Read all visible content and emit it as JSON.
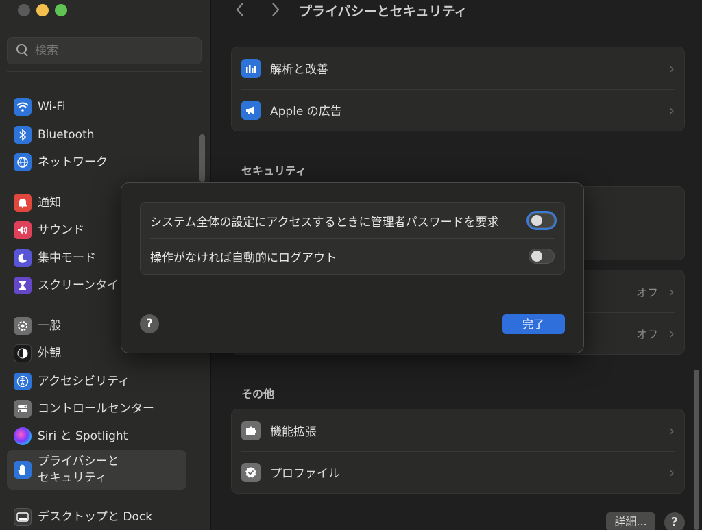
{
  "window": {
    "title": "プライバシーとセキュリティ"
  },
  "search": {
    "placeholder": "検索"
  },
  "sidebar": {
    "items": [
      {
        "label": "Wi-Fi",
        "icon": "wifi-icon"
      },
      {
        "label": "Bluetooth",
        "icon": "bluetooth-icon"
      },
      {
        "label": "ネットワーク",
        "icon": "globe-icon"
      },
      {
        "label": "通知",
        "icon": "bell-icon"
      },
      {
        "label": "サウンド",
        "icon": "speaker-icon"
      },
      {
        "label": "集中モード",
        "icon": "moon-icon"
      },
      {
        "label": "スクリーンタイ",
        "icon": "hourglass-icon"
      },
      {
        "label": "一般",
        "icon": "gear-icon"
      },
      {
        "label": "外観",
        "icon": "appearance-icon"
      },
      {
        "label": "アクセシビリティ",
        "icon": "accessibility-icon"
      },
      {
        "label": "コントロールセンター",
        "icon": "control-center-icon"
      },
      {
        "label": "Siri と Spotlight",
        "icon": "siri-icon"
      },
      {
        "label": "プライバシーと",
        "label2": "セキュリティ",
        "icon": "hand-icon",
        "selected": true
      },
      {
        "label": "デスクトップと Dock",
        "icon": "dock-icon"
      }
    ]
  },
  "main": {
    "privacy_rows": [
      {
        "label": "解析と改善",
        "icon": "chart-icon"
      },
      {
        "label": "Apple の広告",
        "icon": "megaphone-icon"
      }
    ],
    "security_title": "セキュリティ",
    "security_rows": [
      {
        "value": "オフ"
      },
      {
        "value": "オフ"
      }
    ],
    "other_title": "その他",
    "other_rows": [
      {
        "label": "機能拡張",
        "icon": "puzzle-icon"
      },
      {
        "label": "プロファイル",
        "icon": "checkmark-badge-icon"
      }
    ],
    "details_label": "詳細...",
    "help_label": "?"
  },
  "dialog": {
    "rows": [
      {
        "label": "システム全体の設定にアクセスするときに管理者パスワードを要求",
        "on": false
      },
      {
        "label": "操作がなければ自動的にログアウト",
        "on": false
      }
    ],
    "help_label": "?",
    "done_label": "完了"
  },
  "colors": {
    "accent": "#2f6fdc"
  }
}
